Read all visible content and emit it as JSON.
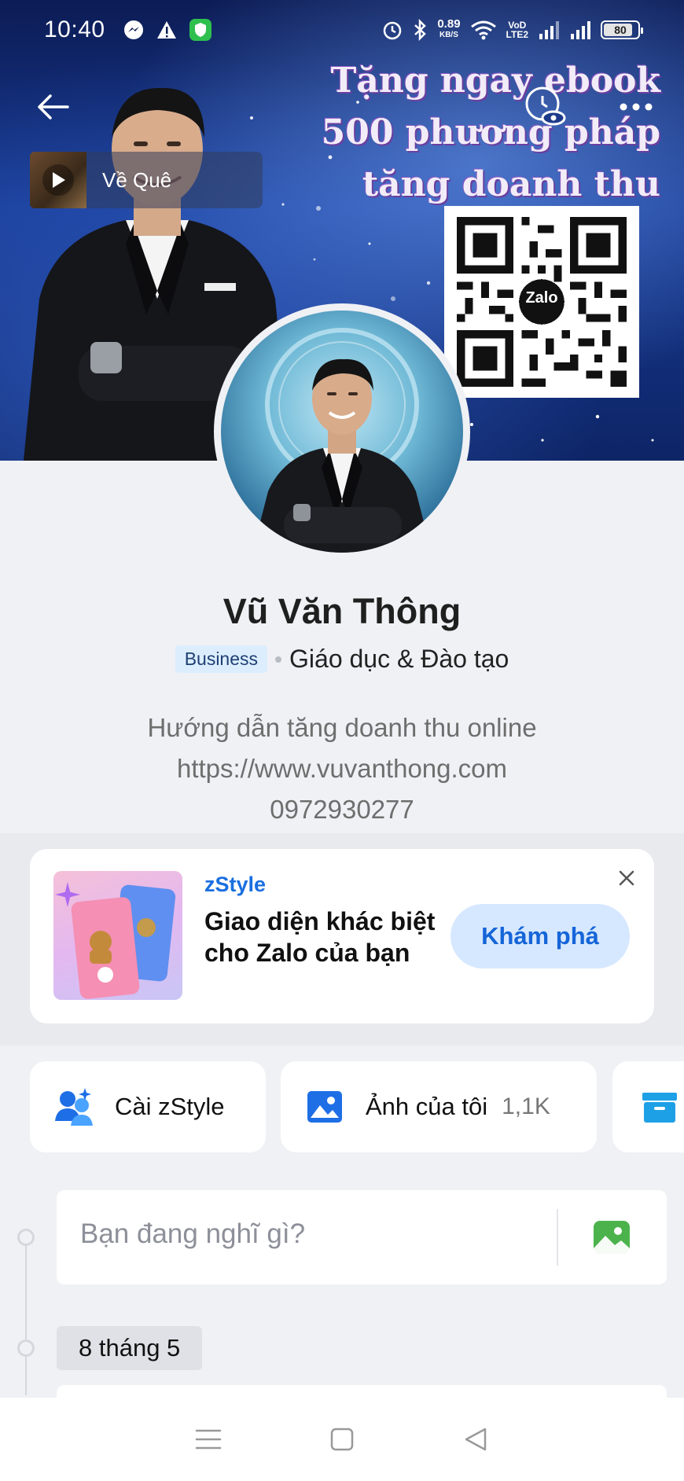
{
  "status_bar": {
    "time": "10:40",
    "speed_value": "0.89",
    "speed_unit": "KB/S",
    "network_1": "VoD",
    "network_2": "LTE2",
    "battery": "80"
  },
  "cover": {
    "music_title": "Về Quê",
    "promo_line_1": "Tặng ngay ebook",
    "promo_line_2": "500 phương pháp",
    "promo_line_3": "tăng doanh thu",
    "qr_logo": "Zalo"
  },
  "profile": {
    "name": "Vũ Văn Thông",
    "badge": "Business",
    "category": "Giáo dục & Đào tạo",
    "bio_line_1": "Hướng dẫn tăng doanh thu online",
    "bio_line_2": "https://www.vuvanthong.com",
    "bio_line_3": "0972930277"
  },
  "zstyle_card": {
    "label": "zStyle",
    "title": "Giao diện khác biệt cho Zalo của bạn",
    "button": "Khám phá"
  },
  "shortcuts": [
    {
      "label": "Cài zStyle",
      "icon": "zstyle-users-icon"
    },
    {
      "label": "Ảnh của tôi",
      "count": "1,1K",
      "icon": "photo-icon"
    },
    {
      "label": "",
      "icon": "archive-icon"
    }
  ],
  "composer": {
    "placeholder": "Bạn đang nghĩ gì?"
  },
  "timeline": {
    "date": "8 tháng 5"
  },
  "colors": {
    "accent": "#1a6fe0",
    "button_bg": "#d6e8ff",
    "page_bg": "#f0f1f5"
  }
}
